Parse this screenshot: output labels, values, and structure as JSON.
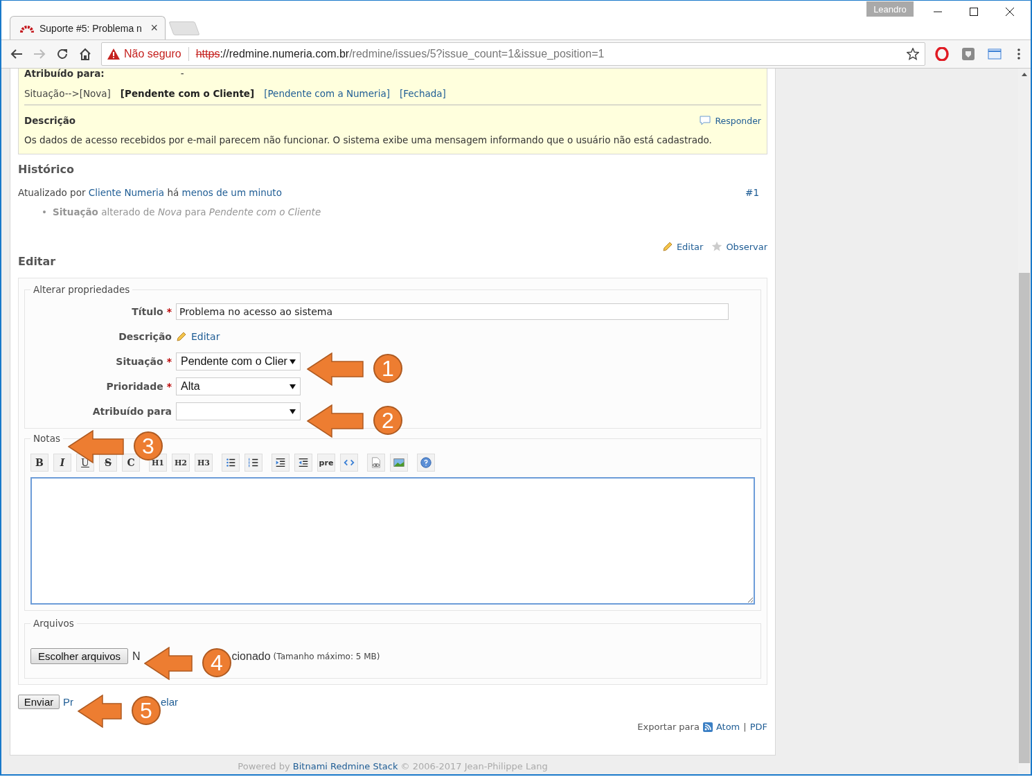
{
  "browser": {
    "tab_title": "Suporte #5: Problema n",
    "tab_close": "×",
    "profile": "Leandro",
    "security": "Não seguro",
    "url_scheme": "https",
    "url_host": "://redmine.numeria.com.br",
    "url_path": "/redmine/issues/5?issue_count=1&issue_position=1"
  },
  "issue": {
    "assigned_label": "Atribuído para:",
    "assigned_value": "-",
    "status_label": "Situação-->",
    "transitions": [
      {
        "label": "[Nova]",
        "kind": "text"
      },
      {
        "label": "[Pendente com o Cliente]",
        "kind": "current"
      },
      {
        "label": "[Pendente com a Numeria]",
        "kind": "link"
      },
      {
        "label": "[Fechada]",
        "kind": "link"
      }
    ],
    "description_heading": "Descrição",
    "reply_link": "Responder",
    "description": "Os dados de acesso recebidos por e-mail parecem não funcionar. O sistema exibe uma mensagem informando que o usuário não está cadastrado."
  },
  "history": {
    "heading": "Histórico",
    "prefix": "Atualizado por",
    "author": "Cliente Numeria",
    "middle": "há",
    "time": "menos de um minuto",
    "number": "#1",
    "bullet": "•",
    "changes": [
      "**Situação** alterado de *Nova* para *Pendente com o Cliente*"
    ]
  },
  "actions": {
    "edit": "Editar",
    "watch": "Observar"
  },
  "edit": {
    "heading": "Editar",
    "properties_legend": "Alterar propriedades",
    "fields": [
      {
        "label": "Título",
        "kind": "text",
        "required": "*",
        "value": "Problema no acesso ao sistema"
      },
      {
        "label": "Descrição",
        "kind": "link",
        "value": "Editar"
      },
      {
        "label": "Situação",
        "kind": "select",
        "required": "*",
        "value": "Pendente com o Clier"
      },
      {
        "label": "Prioridade",
        "kind": "select",
        "required": "*",
        "value": "Alta"
      },
      {
        "label": "Atribuído para",
        "kind": "select"
      }
    ],
    "notes_legend": "Notas",
    "toolbar": [
      {
        "kind": "text",
        "label": "B"
      },
      {
        "kind": "text",
        "label": "I"
      },
      {
        "kind": "text",
        "label": "U"
      },
      {
        "kind": "text",
        "label": "S"
      },
      {
        "kind": "text",
        "label": "C"
      },
      {
        "kind": "text",
        "label": "H1"
      },
      {
        "kind": "text",
        "label": "H2"
      },
      {
        "kind": "text",
        "label": "H3"
      },
      {
        "kind": "icon"
      },
      {
        "kind": "icon"
      },
      {
        "kind": "icon"
      },
      {
        "kind": "icon"
      },
      {
        "kind": "text",
        "label": "pre"
      },
      {
        "kind": "icon"
      },
      {
        "kind": "icon"
      },
      {
        "kind": "icon"
      },
      {
        "kind": "icon"
      }
    ],
    "files_legend": "Arquivos",
    "choose_button": "Escolher arquivos",
    "file_status_parts": [
      "N",
      "cionado"
    ],
    "max_size": "(Tamanho máximo: 5 MB)",
    "submit": "Enviar",
    "link_parts": [
      "Pr",
      "elar"
    ]
  },
  "export": {
    "label": "Exportar para",
    "atom": "Atom",
    "separator": "|",
    "pdf": "PDF"
  },
  "footer": {
    "prefix": "Powered by",
    "link": "Bitnami Redmine Stack",
    "suffix": "© 2006-2017 Jean-Philippe Lang"
  },
  "callouts": [
    {
      "number": "1"
    },
    {
      "number": "2"
    },
    {
      "number": "3"
    },
    {
      "number": "4"
    },
    {
      "number": "5"
    }
  ]
}
